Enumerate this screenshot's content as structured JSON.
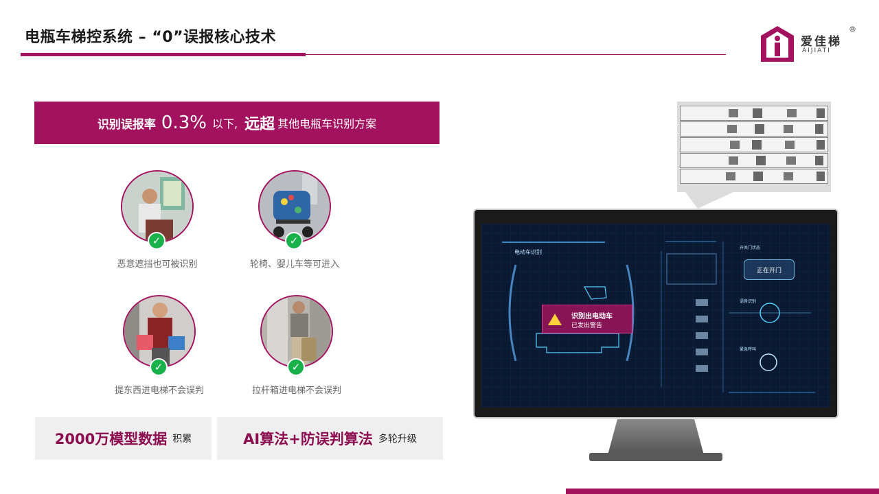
{
  "header": {
    "title": "电瓶车梯控系统 – “0”误报核心技术"
  },
  "logo": {
    "name": "爱佳梯",
    "latin": "AIJIATI",
    "registered": "®"
  },
  "banner": {
    "part1": "识别误报率",
    "rate": "0.3%",
    "part2": "以下,",
    "emphasis": "远超",
    "part3": "其他电瓶车识别方案"
  },
  "cases": [
    {
      "caption": "恶意遮挡也可被识别"
    },
    {
      "caption": "轮椅、婴儿车等可进入"
    },
    {
      "caption": "提东西进电梯不会误判"
    },
    {
      "caption": "拉杆箱进电梯不会误判"
    }
  ],
  "features": [
    {
      "big": "2000万模型数据",
      "small": "积累"
    },
    {
      "big": "AI算法+防误判算法",
      "small": "多轮升级"
    }
  ],
  "dashboard": {
    "panel_title": "电动车识别",
    "alert_title": "识别出电动车",
    "alert_sub": "已发出警告",
    "door_label": "正在开门",
    "door_panel": "开关门状态",
    "voice_panel": "语音识别",
    "call_panel": "紧急呼叫"
  },
  "colors": {
    "brand": "#a3125f",
    "check": "#19b14a",
    "feature_bg": "#efefef"
  }
}
